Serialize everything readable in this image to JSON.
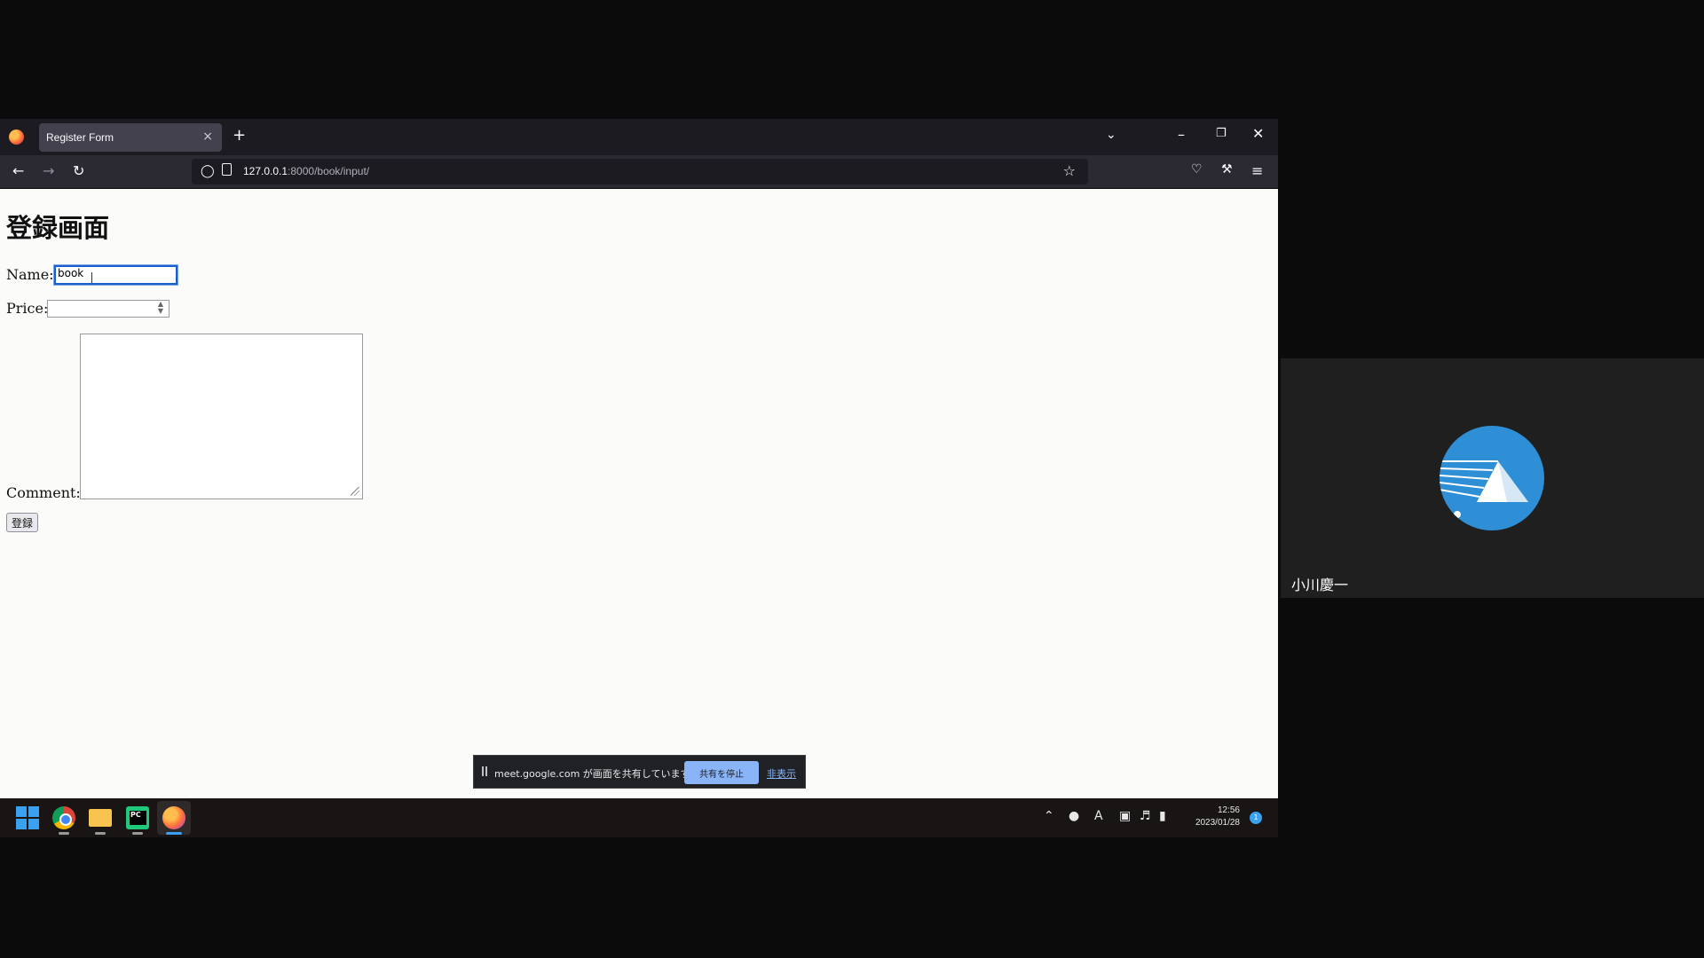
{
  "browser": {
    "tab_title": "Register Form",
    "tab_close": "×",
    "new_tab": "+",
    "url_host": "127.0.0.1",
    "url_path": ":8000/book/input/"
  },
  "page": {
    "heading": "登録画面",
    "name_label": "Name:",
    "name_value": "book",
    "price_label": "Price:",
    "price_value": "",
    "comment_label": "Comment:",
    "comment_value": "",
    "submit_label": "登録"
  },
  "share_banner": {
    "message": "meet.google.com が画面を共有しています。",
    "stop_label": "共有を停止",
    "hide_label": "非表示"
  },
  "taskbar": {
    "time": "12:56",
    "date": "2023/01/28",
    "notification_count": "1",
    "input_mode": "A",
    "apps": [
      "windows-start",
      "chrome",
      "file-explorer",
      "pycharm",
      "firefox"
    ]
  },
  "participant": {
    "name": "小川慶一"
  },
  "colors": {
    "accent": "#1a5fc7",
    "meet_button": "#8ab4f8",
    "avatar_bg": "#2f8fd6"
  }
}
